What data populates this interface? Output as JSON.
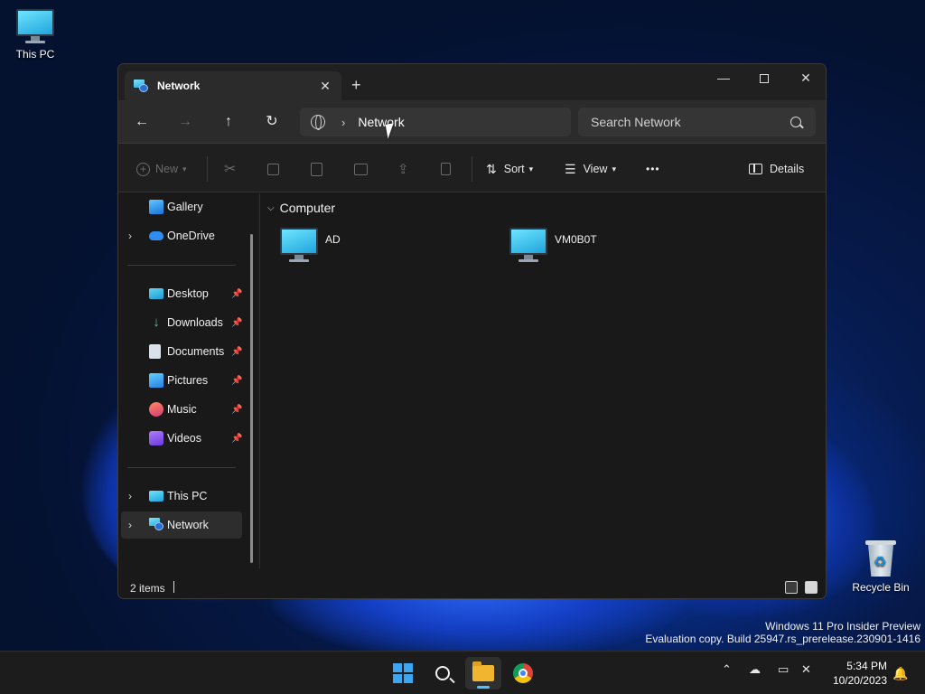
{
  "desktop": {
    "this_pc_label": "This PC",
    "recycle_bin_label": "Recycle Bin",
    "watermark_line1": "Windows 11 Pro Insider Preview",
    "watermark_line2": "Evaluation copy. Build 25947.rs_prerelease.230901-1416"
  },
  "explorer": {
    "tab_title": "Network",
    "tab_close_glyph": "✕",
    "new_tab_glyph": "+",
    "window_controls": {
      "minimize": "—",
      "close": "✕"
    },
    "nav": {
      "back": "←",
      "forward": "→",
      "up": "↑",
      "refresh": "↻"
    },
    "address": {
      "chevron": "›",
      "crumb": "Network"
    },
    "search": {
      "placeholder": "Search Network"
    },
    "commands": {
      "new_label": "New",
      "sort_label": "Sort",
      "view_label": "View",
      "more_label": "•••",
      "details_label": "Details"
    },
    "sidebar": [
      {
        "label": "Gallery",
        "icon": "gallery-icon"
      },
      {
        "label": "OneDrive",
        "icon": "onedrive-icon",
        "expandable": true
      },
      {
        "label": "Desktop",
        "icon": "desktop-folder-icon",
        "pinned": true
      },
      {
        "label": "Downloads",
        "icon": "downloads-icon",
        "pinned": true
      },
      {
        "label": "Documents",
        "icon": "documents-icon",
        "pinned": true
      },
      {
        "label": "Pictures",
        "icon": "pictures-icon",
        "pinned": true
      },
      {
        "label": "Music",
        "icon": "music-icon",
        "pinned": true
      },
      {
        "label": "Videos",
        "icon": "videos-icon",
        "pinned": true
      },
      {
        "label": "This PC",
        "icon": "this-pc-icon",
        "expandable": true
      },
      {
        "label": "Network",
        "icon": "network-icon",
        "expandable": true,
        "selected": true
      }
    ],
    "expand_glyph": "›",
    "pin_glyph": "📌",
    "group": {
      "chevron": "⌵",
      "label": "Computer"
    },
    "items": [
      {
        "label": "AD",
        "icon": "computer-icon"
      },
      {
        "label": "VM0B0T",
        "icon": "computer-icon"
      }
    ],
    "status": {
      "count": "2 items"
    }
  },
  "taskbar": {
    "apps": [
      "start-icon",
      "search-icon",
      "file-explorer-icon",
      "chrome-icon"
    ],
    "active_app": "file-explorer-icon",
    "tray_chevron": "⌃",
    "time": "5:34 PM",
    "date": "10/20/2023",
    "bell_glyph": "🔔"
  },
  "colors": {
    "accent": "#4cc2ff",
    "window_bg": "#191919",
    "titlebar_bg": "#202020"
  }
}
